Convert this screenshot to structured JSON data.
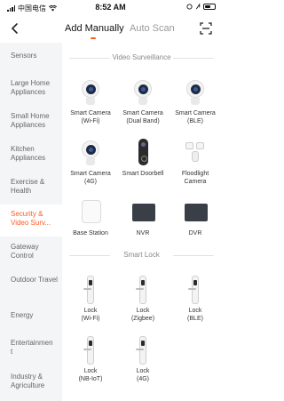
{
  "status_bar": {
    "carrier": "中国电信",
    "time": "8:52 AM",
    "battery_icon": "battery-icon",
    "wifi_icon": "wifi-icon"
  },
  "nav": {
    "tab_add": "Add Manually",
    "tab_auto": "Auto Scan",
    "accent": "#ff5a28"
  },
  "sidebar": {
    "items": [
      {
        "label": "Sensors"
      },
      {
        "label": "Large Home Appliances"
      },
      {
        "label": "Small Home Appliances"
      },
      {
        "label": "Kitchen Appliances"
      },
      {
        "label": "Exercise & Health"
      },
      {
        "label": "Security & Video Surv..."
      },
      {
        "label": "Gateway Control"
      },
      {
        "label": "Outdoor Travel"
      },
      {
        "label": "Energy"
      },
      {
        "label": "Entertainment"
      },
      {
        "label": "Industry & Agriculture"
      }
    ]
  },
  "sections": [
    {
      "title": "Video Surveillance",
      "devices": [
        {
          "label": "Smart Camera\n(Wi-Fi)"
        },
        {
          "label": "Smart Camera\n(Dual Band)"
        },
        {
          "label": "Smart Camera\n(BLE)"
        },
        {
          "label": "Smart Camera\n(4G)"
        },
        {
          "label": "Smart Doorbell"
        },
        {
          "label": "Floodlight\nCamera"
        },
        {
          "label": "Base Station"
        },
        {
          "label": "NVR"
        },
        {
          "label": "DVR"
        }
      ]
    },
    {
      "title": "Smart Lock",
      "devices": [
        {
          "label": "Lock\n(Wi-Fi)"
        },
        {
          "label": "Lock\n(Zigbee)"
        },
        {
          "label": "Lock\n(BLE)"
        },
        {
          "label": "Lock\n(NB-IoT)"
        },
        {
          "label": "Lock\n(4G)"
        }
      ]
    }
  ]
}
